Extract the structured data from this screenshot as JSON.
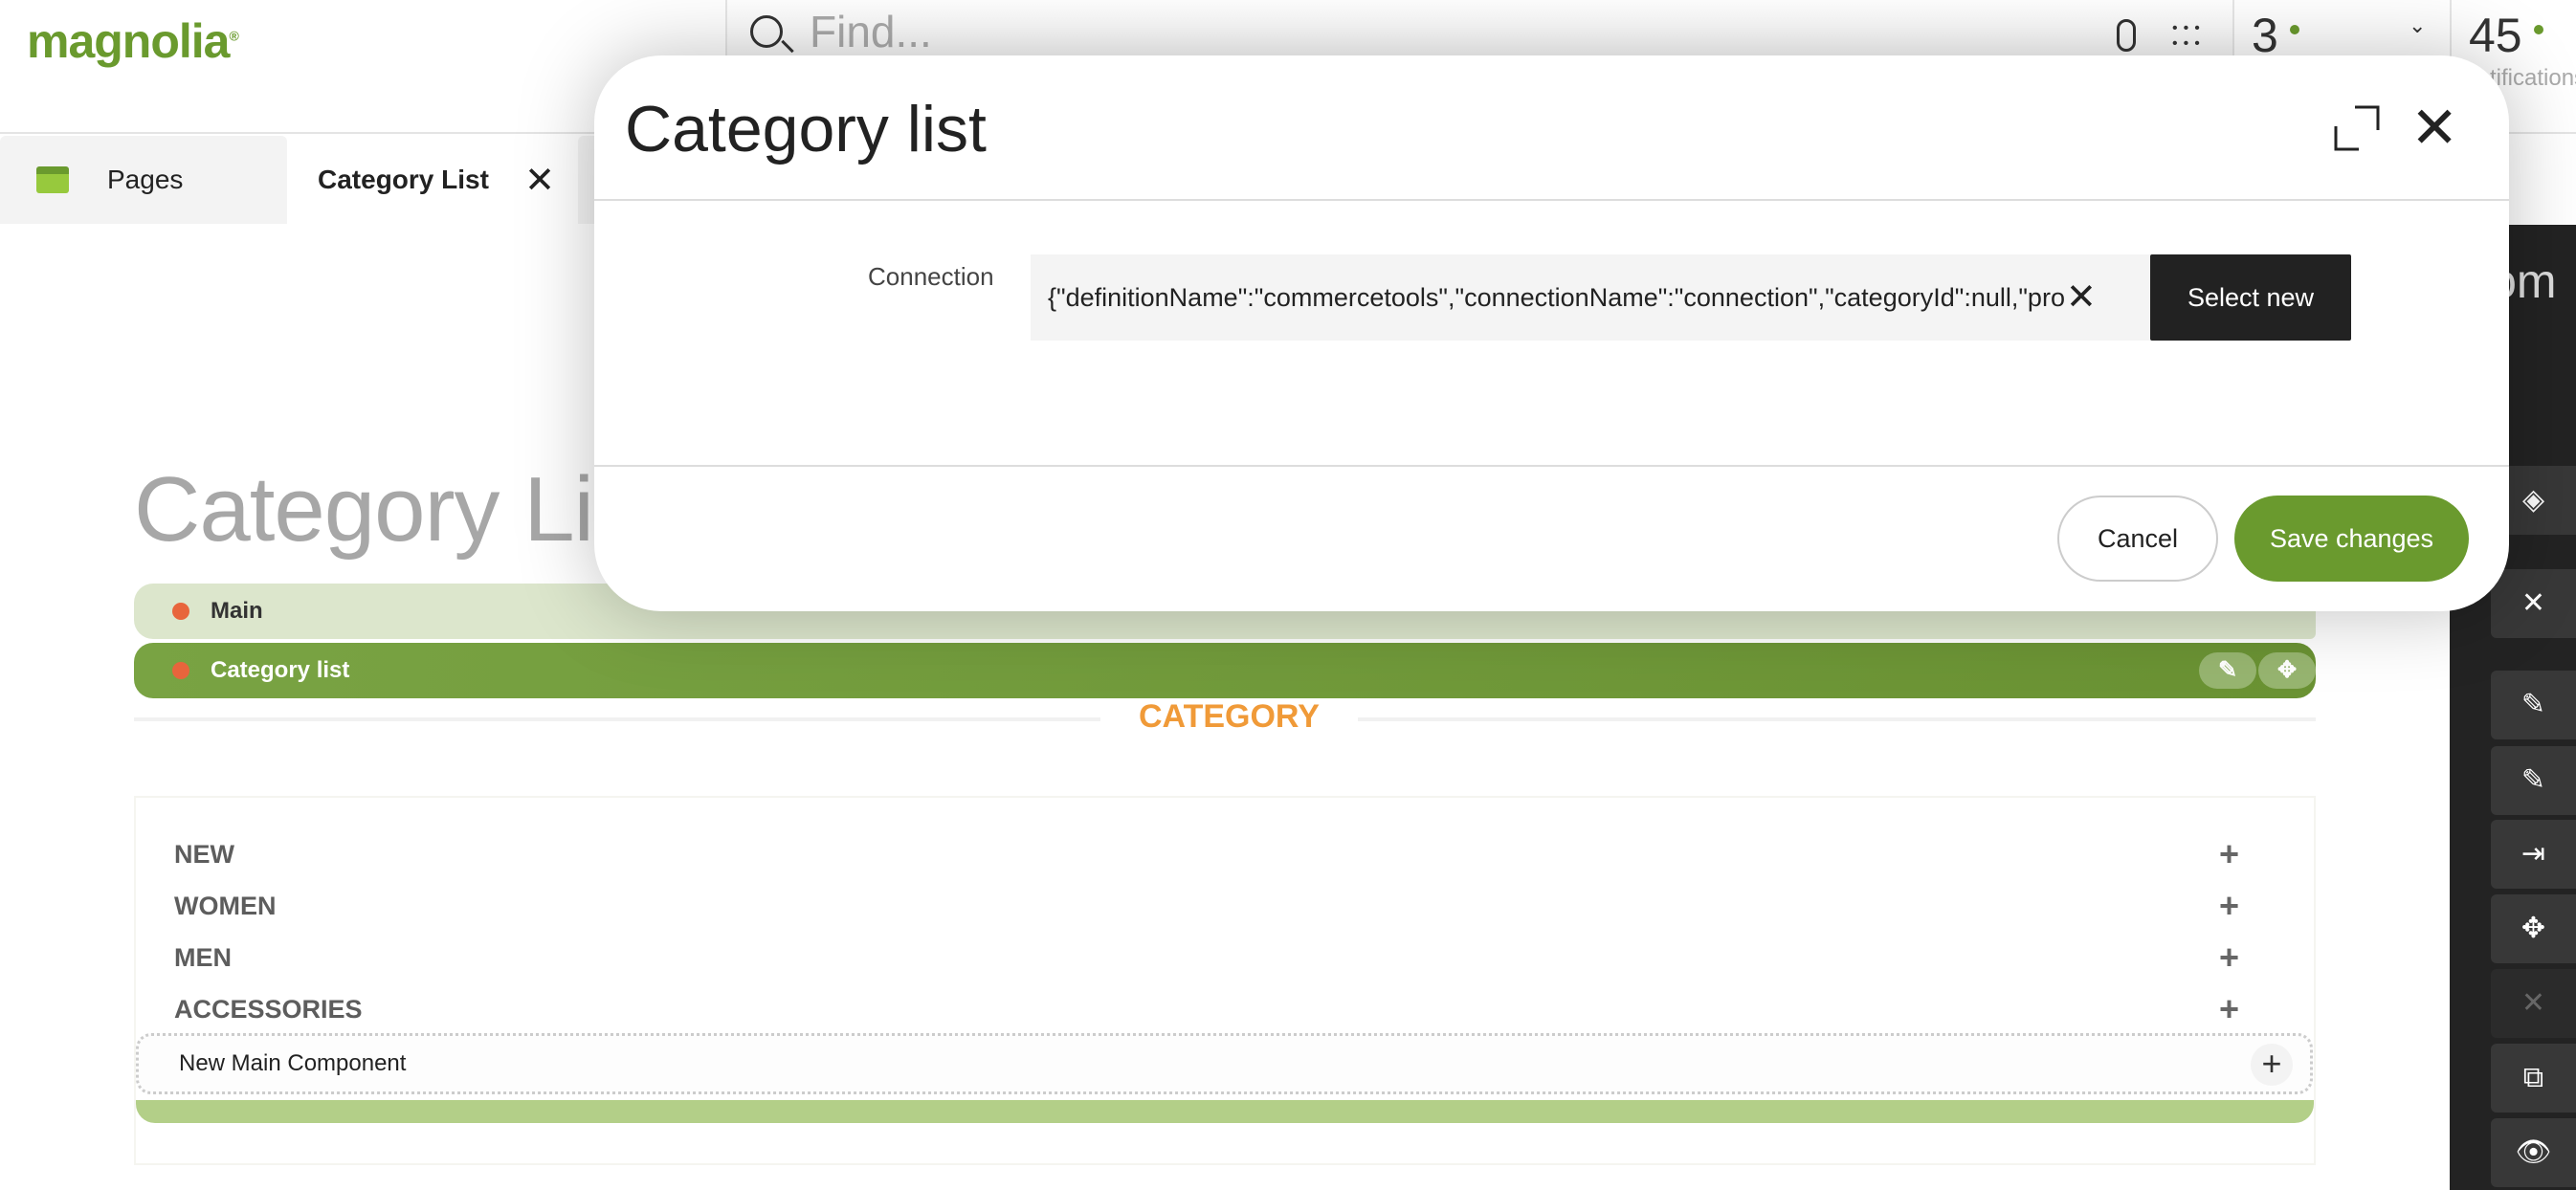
{
  "header": {
    "logo": "magnolia",
    "search_placeholder": "Find...",
    "apps_count": "3",
    "notifications_count": "45",
    "notifications_label": "tifications"
  },
  "tabs": [
    {
      "label": "Pages",
      "icon": "pages-icon"
    },
    {
      "label": "Category List",
      "icon": "close-icon"
    }
  ],
  "page": {
    "title": "Category List",
    "areas": {
      "main": "Main",
      "component": "Category list"
    },
    "category_heading": "CATEGORY",
    "items": [
      "NEW",
      "WOMEN",
      "MEN",
      "ACCESSORIES"
    ],
    "new_component": "New Main Component"
  },
  "right_panel": {
    "title": "Com",
    "buttons": [
      "eye-tag-icon",
      "close-icon",
      "pencil-icon",
      "pencil-icon",
      "move-in-icon",
      "move-icon",
      "close-icon",
      "copy-icon",
      "eye-icon"
    ]
  },
  "modal": {
    "title": "Category list",
    "connection_label": "Connection",
    "connection_value": "{\"definitionName\":\"commercetools\",\"connectionName\":\"connection\",\"categoryId\":null,\"pro",
    "select_new": "Select new",
    "cancel": "Cancel",
    "save": "Save changes"
  },
  "colors": {
    "brand": "#6a9a2e",
    "accent_orange": "#f09a38",
    "status_dot": "#e8653c"
  }
}
